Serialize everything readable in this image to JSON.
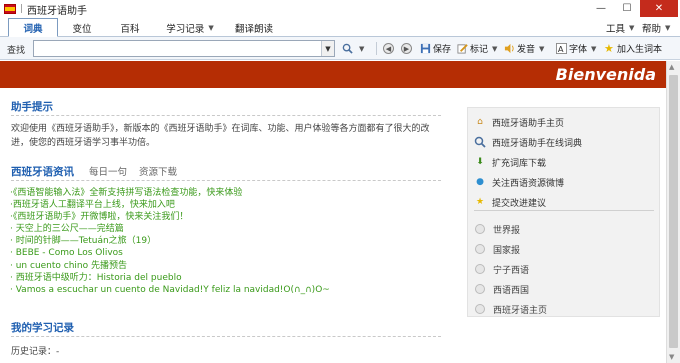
{
  "window": {
    "title": "西班牙语助手",
    "minimize": "—",
    "maximize": "☐",
    "close": "✕"
  },
  "tabs": [
    {
      "label": "词典",
      "active": true
    },
    {
      "label": "变位"
    },
    {
      "label": "百科"
    },
    {
      "label": "学习记录",
      "dropdown": true
    },
    {
      "label": "翻译朗读"
    }
  ],
  "menu": {
    "tools": "工具",
    "help": "帮助"
  },
  "toolbar": {
    "search_label": "查找",
    "search_value": "",
    "save": "保存",
    "bookmark": "标记",
    "pronounce": "发音",
    "font": "字体",
    "add_vocab": "加入生词本"
  },
  "banner": {
    "text": "Bienvenida",
    "color": "#b52d04"
  },
  "assistant": {
    "title": "助手提示",
    "intro": "欢迎使用《西班牙语助手》，新版本的《西班牙语助手》在词库、功能、用户体验等各方面都有了很大的改进，使您的西班牙语学习事半功倍。"
  },
  "news": {
    "title": "西班牙语资讯",
    "subtabs": [
      "每日一句",
      "资源下载"
    ],
    "items": [
      "·《西语智能输入法》全新支持拼写语法检查功能，快来体验",
      "·西班牙语人工翻译平台上线，快来加入吧",
      "·《西班牙语助手》开微博啦，快来关注我们！",
      "· 天空上的三公尺——完结篇",
      "· 时间的针脚——Tetuán之旅（19）",
      "· BEBE - Como Los Olivos",
      "· un cuento chino 先播预告",
      "· 西班牙语中级听力：Historia del pueblo",
      "· Vamos a escuchar un cuento de Navidad!Y feliz la navidad!O(∩_∩)O~"
    ],
    "color": "#3a9a1a"
  },
  "records": {
    "title": "我的学习记录",
    "history_label": "历史记录：-"
  },
  "side_links": [
    {
      "label": "西班牙语助手主页",
      "icon": "home-icon"
    },
    {
      "label": "西班牙语助手在线词典",
      "icon": "magnifier-icon"
    },
    {
      "label": "扩充词库下载",
      "icon": "download-arrow-icon"
    },
    {
      "label": "关注西语资源微博",
      "icon": "globe-icon"
    },
    {
      "label": "提交改进建议",
      "icon": "star-icon"
    }
  ],
  "side_radios": [
    "世界报",
    "国家报",
    "宁子西语",
    "西语西国",
    "西班牙语主页"
  ]
}
